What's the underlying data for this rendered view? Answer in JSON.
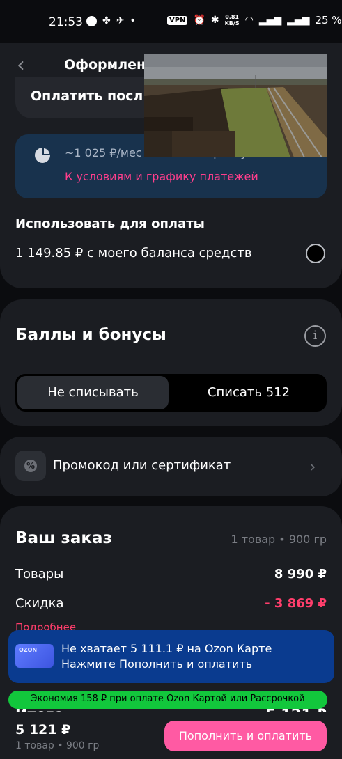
{
  "status_bar": {
    "time": "21:53",
    "vpn": "VPN",
    "speed_value": "0.81",
    "speed_unit": "KB/S",
    "battery": "25 %"
  },
  "header": {
    "title": "Оформление заказа",
    "pay_later_label": "Оплатить после"
  },
  "installment": {
    "amount_text": "~1 025 ₽/мес в Ozon Рассрочку",
    "link": "К условиям и графику платежей",
    "link_color": "#ff3e8c"
  },
  "balance": {
    "label": "Использовать для оплаты",
    "text": "1 149.85 ₽ с моего баланса средств"
  },
  "bonuses": {
    "title": "Баллы и бонусы",
    "option_no": "Не списывать",
    "option_yes": "Списать 512"
  },
  "promo": {
    "label": "Промокод или сертификат"
  },
  "order": {
    "title": "Ваш заказ",
    "meta": "1 товар • 900 гр",
    "goods_label": "Товары",
    "goods_value": "8 990 ₽",
    "discount_label": "Скидка",
    "discount_value": "- 3 869 ₽",
    "more_link": "Подробнее",
    "total_label": "Итого",
    "total_value": "5 121 ₽"
  },
  "banner": {
    "card_logo": "OZON",
    "line1": "Не хватает 5 111.1 ₽ на Ozon Карте",
    "line2": "Нажмите Пополнить и оплатить"
  },
  "savings": {
    "text": "Экономия 158 ₽ при оплате Ozon Картой или Рассрочкой"
  },
  "bottom": {
    "total": "5 121 ₽",
    "meta": "1 товар • 900 гр",
    "pay_button": "Пополнить и оплатить",
    "accent_color": "#ff5aa3"
  }
}
